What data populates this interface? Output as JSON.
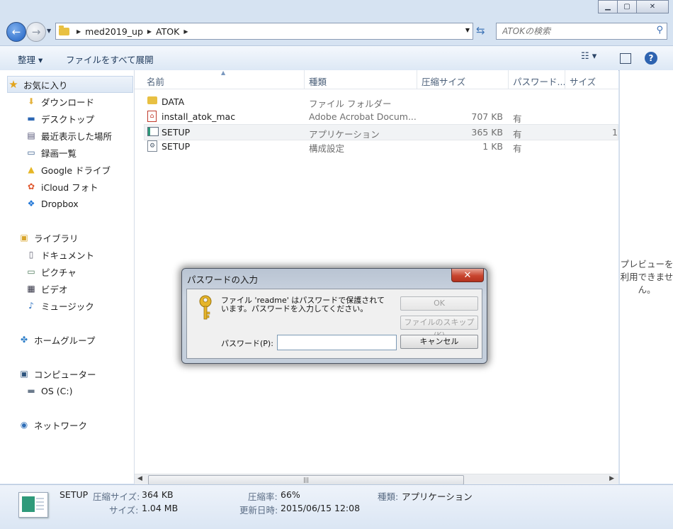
{
  "window": {
    "caption_buttons": [
      "minimize",
      "maximize",
      "close"
    ]
  },
  "address": {
    "crumbs": [
      "med2019_up",
      "ATOK"
    ],
    "search_placeholder": "ATOKの検索"
  },
  "toolbar": {
    "organize_label": "整理 ▾",
    "extract_label": "ファイルをすべて展開"
  },
  "sidebar": {
    "favorites_label": "お気に入り",
    "favorites": [
      {
        "label": "ダウンロード",
        "icon": "download-folder-icon"
      },
      {
        "label": "デスクトップ",
        "icon": "desktop-icon"
      },
      {
        "label": "最近表示した場所",
        "icon": "recent-places-icon"
      },
      {
        "label": "録画一覧",
        "icon": "recordings-icon"
      },
      {
        "label": "Google ドライブ",
        "icon": "google-drive-icon"
      },
      {
        "label": "iCloud フォト",
        "icon": "icloud-photos-icon"
      },
      {
        "label": "Dropbox",
        "icon": "dropbox-icon"
      }
    ],
    "libraries_label": "ライブラリ",
    "libraries": [
      {
        "label": "ドキュメント",
        "icon": "documents-icon"
      },
      {
        "label": "ピクチャ",
        "icon": "pictures-icon"
      },
      {
        "label": "ビデオ",
        "icon": "videos-icon"
      },
      {
        "label": "ミュージック",
        "icon": "music-icon"
      }
    ],
    "homegroup_label": "ホームグループ",
    "computer_label": "コンピューター",
    "drive_label": "OS (C:)",
    "network_label": "ネットワーク"
  },
  "columns": [
    "名前",
    "種類",
    "圧縮サイズ",
    "パスワード...",
    "サイズ"
  ],
  "files": [
    {
      "name": "DATA",
      "type": "ファイル フォルダー",
      "size": "",
      "password": "",
      "extra": "",
      "icon": "folder-icon"
    },
    {
      "name": "install_atok_mac",
      "type": "Adobe Acrobat Docum...",
      "size": "707 KB",
      "password": "有",
      "extra": "",
      "icon": "pdf-icon"
    },
    {
      "name": "SETUP",
      "type": "アプリケーション",
      "size": "365 KB",
      "password": "有",
      "extra": "1",
      "icon": "application-icon"
    },
    {
      "name": "SETUP",
      "type": "構成設定",
      "size": "1 KB",
      "password": "有",
      "extra": "",
      "icon": "config-file-icon"
    }
  ],
  "preview": {
    "message": "プレビューを利用できません。"
  },
  "details": {
    "name": "SETUP",
    "compressed_label": "圧縮サイズ:",
    "compressed_value": "364 KB",
    "ratio_label": "圧縮率:",
    "ratio_value": "66%",
    "type_label": "種類:",
    "type_value": "アプリケーション",
    "size_label": "サイズ:",
    "size_value": "1.04 MB",
    "modified_label": "更新日時:",
    "modified_value": "2015/06/15 12:08"
  },
  "dialog": {
    "title": "パスワードの入力",
    "message": "ファイル 'readme' はパスワードで保護されています。パスワードを入力してください。",
    "password_label": "パスワード(P):",
    "password_value": "",
    "ok_label": "OK",
    "skip_label": "ファイルのスキップ(K)",
    "cancel_label": "キャンセル"
  }
}
